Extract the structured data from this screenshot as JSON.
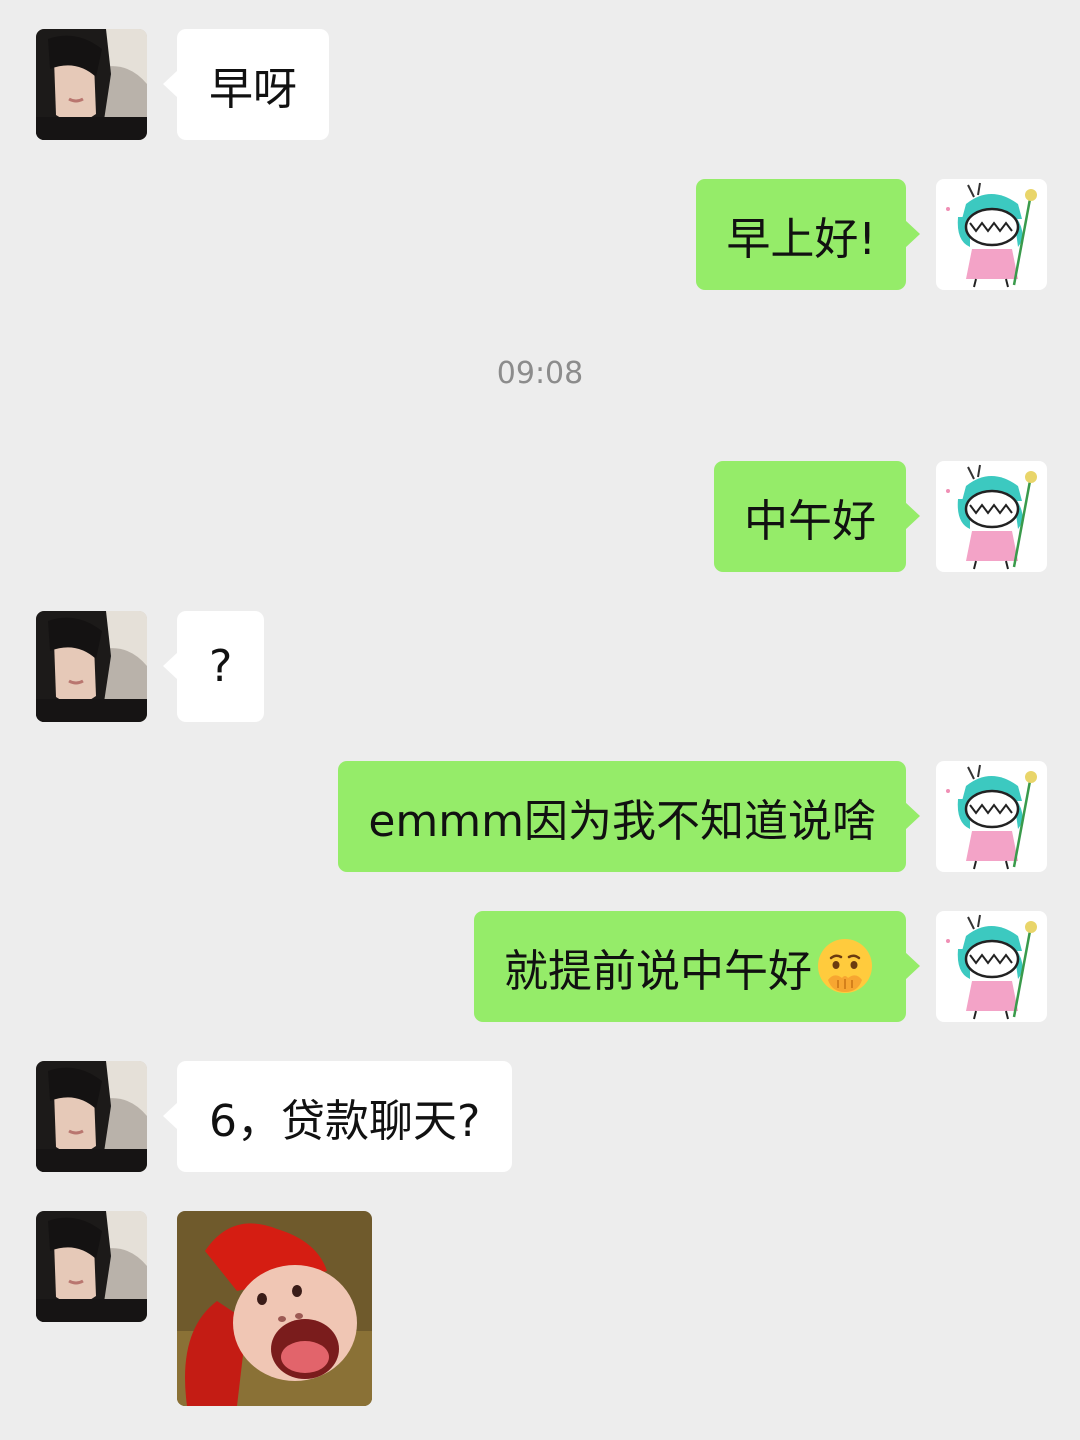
{
  "chat": {
    "timestamp": "09:08",
    "messages": [
      {
        "side": "left",
        "text": "早呀"
      },
      {
        "side": "right",
        "text": "早上好!"
      },
      {
        "side": "right",
        "text": "中午好"
      },
      {
        "side": "left",
        "text": "?"
      },
      {
        "side": "right",
        "text": "emmm因为我不知道说啥"
      },
      {
        "side": "right",
        "text": "就提前说中午好",
        "emoji": "pleading-face-hand-over-mouth-emoji"
      },
      {
        "side": "left",
        "text": "6，贷款聊天?"
      },
      {
        "side": "left",
        "type": "sticker",
        "sticker": "screaming-pig-sticker"
      }
    ]
  },
  "colors": {
    "background": "#ededed",
    "incoming_bubble": "#ffffff",
    "outgoing_bubble": "#95ec69",
    "timestamp_text": "#8c8c8c"
  }
}
